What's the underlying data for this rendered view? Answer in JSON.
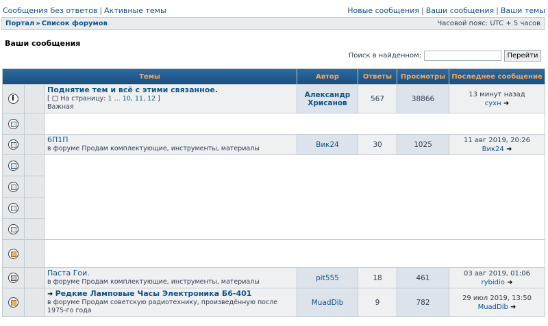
{
  "topbar": {
    "left": [
      "Сообщения без ответов",
      "Активные темы"
    ],
    "right": [
      "Новые сообщения",
      "Ваши сообщения",
      "Ваши темы"
    ]
  },
  "nav": {
    "portal": "Портал",
    "raquo": "»",
    "forums": "Список форумов",
    "timezone": "Часовой пояс: UTC + 5 часов"
  },
  "page_title": "Ваши сообщения",
  "search": {
    "label": "Поиск в найденном:",
    "value": "",
    "button": "Перейти"
  },
  "columns": {
    "topics": "Темы",
    "author": "Автор",
    "replies": "Ответы",
    "views": "Просмотры",
    "last": "Последнее сообщение"
  },
  "rows": [
    {
      "title": "Поднятие тем и всё с этими связанное.",
      "pages_prefix": "[",
      "pages_label": "На страницу:",
      "pages": [
        "1",
        "...",
        "10,",
        "11,",
        "12"
      ],
      "pages_suffix": "]",
      "tag": "Важная",
      "author": "Александр Хрисанов",
      "replies": "567",
      "views": "38866",
      "last_time": "13 минут назад",
      "last_user": "сухн"
    },
    {
      "title": "6П1П",
      "forum_prefix": "в форуме",
      "forum": "Продам комплектующие, инструменты, материалы",
      "author": "Вик24",
      "replies": "30",
      "views": "1025",
      "last_time": "11 авг 2019, 20:26",
      "last_user": "Вик24"
    },
    {
      "title": "Паста Гои.",
      "forum_prefix": "в форуме",
      "forum": "Продам комплектующие, инструменты, материалы",
      "author": "pit555",
      "replies": "18",
      "views": "461",
      "last_time": "03 авг 2019, 01:06",
      "last_user": "rybidio"
    },
    {
      "title": "Редкие Ламповые Часы Электроника Б6-401",
      "forum_prefix": "в форуме",
      "forum": "Продам советскую радиотехнику, произведённую после 1975-го года",
      "author": "MuadDib",
      "replies": "9",
      "views": "782",
      "last_time": "29 июл 2019, 13:50",
      "last_user": "MuadDib"
    }
  ],
  "icons": {
    "arrow": "➜",
    "doc": "▢"
  }
}
